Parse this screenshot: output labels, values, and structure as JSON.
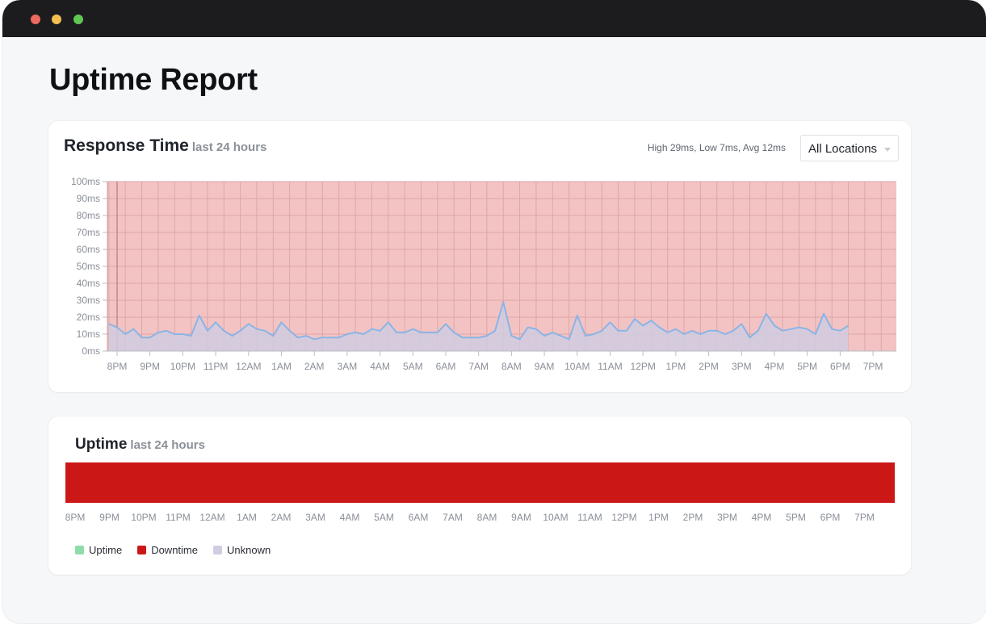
{
  "page": {
    "title": "Uptime Report"
  },
  "response_time": {
    "title": "Response Time",
    "subtitle": "last 24 hours",
    "stats": "High 29ms, Low 7ms, Avg 12ms",
    "location_select": {
      "selected": "All Locations"
    }
  },
  "uptime": {
    "title": "Uptime",
    "subtitle": "last 24 hours",
    "x_ticks": [
      "8PM",
      "9PM",
      "10PM",
      "11PM",
      "12AM",
      "1AM",
      "2AM",
      "3AM",
      "4AM",
      "5AM",
      "6AM",
      "7AM",
      "8AM",
      "9AM",
      "10AM",
      "11AM",
      "12PM",
      "1PM",
      "2PM",
      "3PM",
      "4PM",
      "5PM",
      "6PM",
      "7PM"
    ],
    "status": "Downtime",
    "legend": [
      {
        "label": "Uptime",
        "color": "#8fdcab"
      },
      {
        "label": "Downtime",
        "color": "#cc1717"
      },
      {
        "label": "Unknown",
        "color": "#cfcde0"
      }
    ]
  },
  "colors": {
    "downtime_band": "#f3c3c3",
    "downtime_bar": "#cc1717",
    "line": "#8ab4e6",
    "area": "#cfcde0",
    "grid": "#dca6a8"
  },
  "chart_data": [
    {
      "type": "area",
      "title": "Response Time",
      "y_ticks": [
        "0ms",
        "10ms",
        "20ms",
        "30ms",
        "40ms",
        "50ms",
        "60ms",
        "70ms",
        "80ms",
        "90ms",
        "100ms"
      ],
      "x_ticks": [
        "8PM",
        "9PM",
        "10PM",
        "11PM",
        "12AM",
        "1AM",
        "2AM",
        "3AM",
        "4AM",
        "5AM",
        "6AM",
        "7AM",
        "8AM",
        "9AM",
        "10AM",
        "11AM",
        "12PM",
        "1PM",
        "2PM",
        "3PM",
        "4PM",
        "5PM",
        "6PM",
        "7PM"
      ],
      "ylim": [
        0,
        100
      ],
      "x_unit_start": "7:45PM",
      "x_step_hours": 0.25,
      "series": [
        {
          "values": [
            16,
            14,
            10,
            13,
            8,
            8,
            11,
            12,
            10,
            10,
            9,
            21,
            12,
            17,
            12,
            9,
            12,
            16,
            13,
            12,
            9,
            17,
            12,
            8,
            9,
            7,
            8,
            8,
            8,
            10,
            11,
            10,
            13,
            12,
            17,
            11,
            11,
            13,
            11,
            11,
            11,
            16,
            11,
            8,
            8,
            8,
            9,
            12,
            29,
            9,
            7,
            14,
            13,
            9,
            11,
            9,
            7,
            21,
            9,
            10,
            12,
            17,
            12,
            12,
            19,
            15,
            18,
            14,
            11,
            13,
            10,
            12,
            10,
            12,
            12,
            10,
            12,
            16,
            8,
            12,
            22,
            15,
            12,
            13,
            14,
            13,
            10,
            22,
            13,
            12,
            15
          ]
        }
      ],
      "grid": true
    },
    {
      "type": "bar",
      "title": "Uptime",
      "categories": [
        "Downtime"
      ],
      "x_ticks": [
        "8PM",
        "9PM",
        "10PM",
        "11PM",
        "12AM",
        "1AM",
        "2AM",
        "3AM",
        "4AM",
        "5AM",
        "6AM",
        "7AM",
        "8AM",
        "9AM",
        "10AM",
        "11AM",
        "12PM",
        "1PM",
        "2PM",
        "3PM",
        "4PM",
        "5PM",
        "6PM",
        "7PM"
      ],
      "values": [
        1.0
      ]
    }
  ]
}
